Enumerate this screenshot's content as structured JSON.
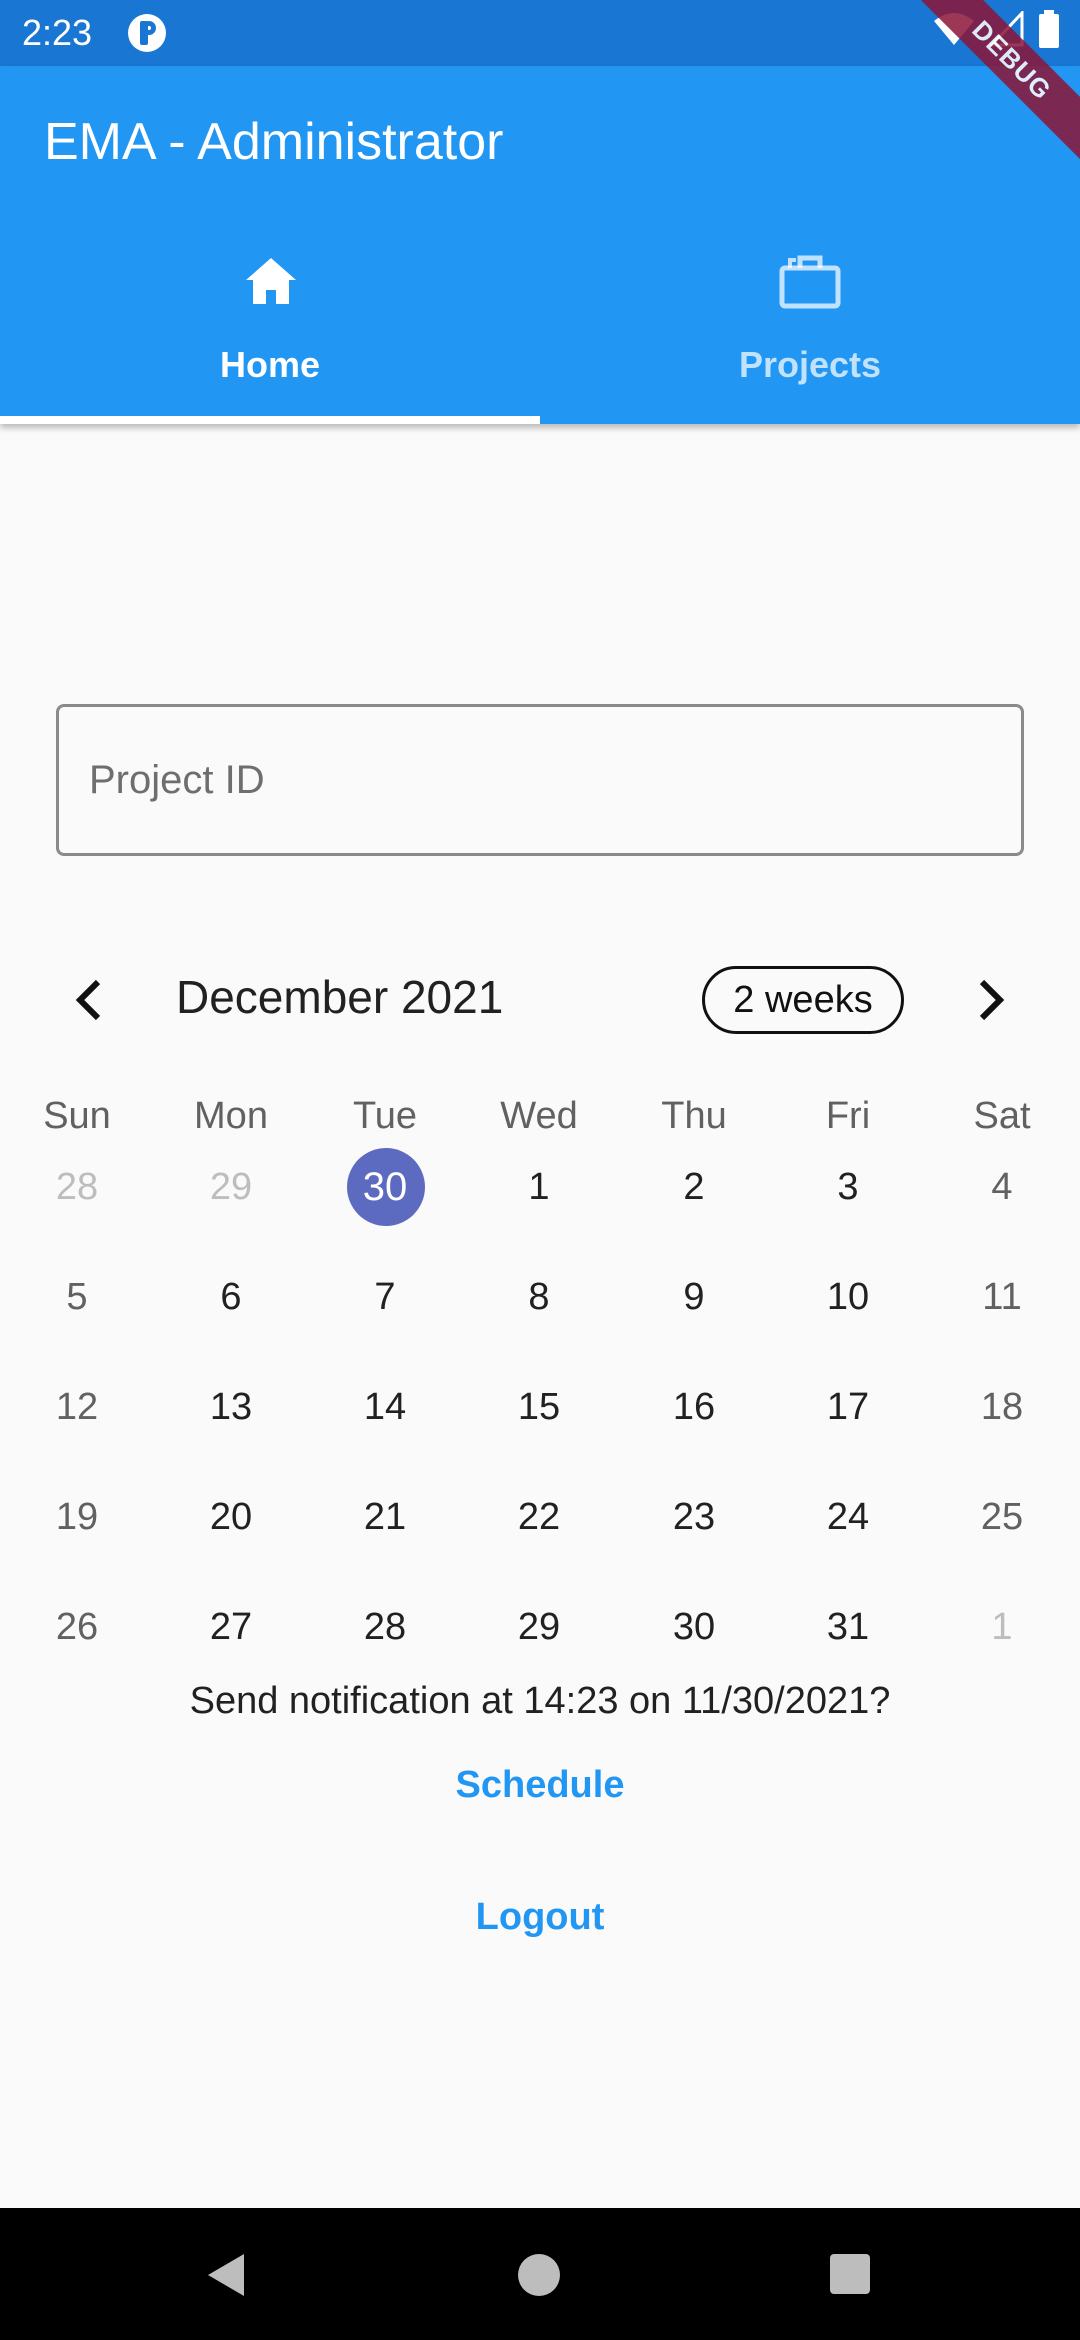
{
  "status_bar": {
    "time": "2:23"
  },
  "debug_banner": "DEBUG",
  "app_bar": {
    "title": "EMA - Administrator"
  },
  "tabs": [
    {
      "label": "Home",
      "icon": "home-icon",
      "selected": true
    },
    {
      "label": "Projects",
      "icon": "briefcase-icon",
      "selected": false
    }
  ],
  "project_field": {
    "placeholder": "Project ID",
    "value": ""
  },
  "calendar": {
    "month_label": "December 2021",
    "format_button": "2 weeks",
    "days_of_week": [
      "Sun",
      "Mon",
      "Tue",
      "Wed",
      "Thu",
      "Fri",
      "Sat"
    ],
    "weeks": [
      [
        "28",
        "29",
        "30",
        "1",
        "2",
        "3",
        "4"
      ],
      [
        "5",
        "6",
        "7",
        "8",
        "9",
        "10",
        "11"
      ],
      [
        "12",
        "13",
        "14",
        "15",
        "16",
        "17",
        "18"
      ],
      [
        "19",
        "20",
        "21",
        "22",
        "23",
        "24",
        "25"
      ],
      [
        "26",
        "27",
        "28",
        "29",
        "30",
        "31",
        "1"
      ]
    ],
    "selected_day": "30"
  },
  "notification": {
    "text": "Send notification at 14:23 on 11/30/2021?"
  },
  "buttons": {
    "schedule": "Schedule",
    "logout": "Logout"
  },
  "colors": {
    "status_bar": "#1976d2",
    "app_bar": "#2196f3",
    "accent": "#2196f3",
    "selected_day": "#5c6bc0"
  }
}
